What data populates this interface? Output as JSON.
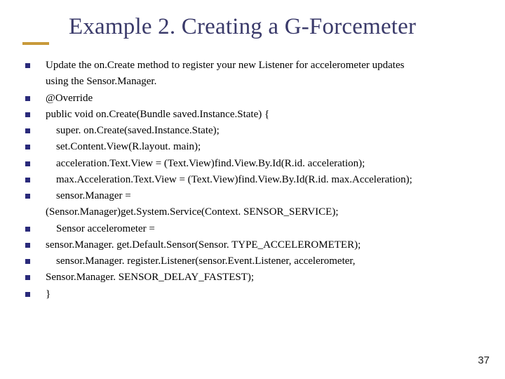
{
  "title": "Example 2. Creating a G-Forcemeter",
  "lines": [
    {
      "bullet": true,
      "text": "Update the on.Create method to register your new Listener for accelerometer updates"
    },
    {
      "bullet": false,
      "text": "using the Sensor.Manager."
    },
    {
      "bullet": true,
      "text": "@Override"
    },
    {
      "bullet": true,
      "text": "public void on.Create(Bundle saved.Instance.State) {"
    },
    {
      "bullet": true,
      "text": "    super. on.Create(saved.Instance.State);"
    },
    {
      "bullet": true,
      "text": "    set.Content.View(R.layout. main);"
    },
    {
      "bullet": true,
      "text": "    acceleration.Text.View = (Text.View)find.View.By.Id(R.id. acceleration);"
    },
    {
      "bullet": true,
      "text": "    max.Acceleration.Text.View = (Text.View)find.View.By.Id(R.id. max.Acceleration);"
    },
    {
      "bullet": true,
      "text": "    sensor.Manager ="
    },
    {
      "bullet": false,
      "text": "(Sensor.Manager)get.System.Service(Context. SENSOR_SERVICE);"
    },
    {
      "bullet": true,
      "text": "    Sensor accelerometer ="
    },
    {
      "bullet": true,
      "text": " sensor.Manager. get.Default.Sensor(Sensor. TYPE_ACCELEROMETER);"
    },
    {
      "bullet": true,
      "text": "    sensor.Manager. register.Listener(sensor.Event.Listener, accelerometer,"
    },
    {
      "bullet": true,
      "text": " Sensor.Manager. SENSOR_DELAY_FASTEST);"
    },
    {
      "bullet": true,
      "text": "}"
    }
  ],
  "page_number": "37"
}
